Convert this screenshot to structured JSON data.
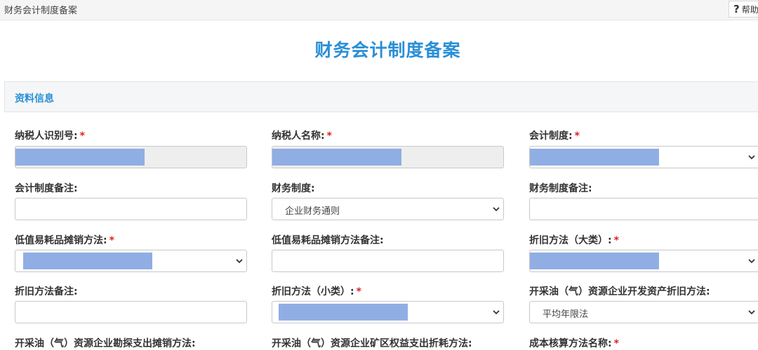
{
  "breadcrumb": "财务会计制度备案",
  "help": {
    "icon": "?",
    "label": "帮助"
  },
  "title": "财务会计制度备案",
  "section": {
    "title": "资料信息"
  },
  "colors": {
    "accent": "#2a8fd6",
    "required": "#e02020",
    "redaction": "#90aee4"
  },
  "fields": {
    "taxpayer_id": {
      "label": "纳税人识别号:",
      "required": "*"
    },
    "taxpayer_name": {
      "label": "纳税人名称:",
      "required": "*"
    },
    "accounting_system": {
      "label": "会计制度:",
      "required": "*"
    },
    "accounting_system_note": {
      "label": "会计制度备注:",
      "value": ""
    },
    "financial_system": {
      "label": "财务制度:",
      "value": "企业财务通则"
    },
    "financial_system_note": {
      "label": "财务制度备注:",
      "value": ""
    },
    "low_value_amortization": {
      "label": "低值易耗品摊销方法:",
      "required": "*"
    },
    "low_value_amortization_note": {
      "label": "低值易耗品摊销方法备注:",
      "value": ""
    },
    "depreciation_major": {
      "label": "折旧方法（大类）:",
      "required": "*"
    },
    "depreciation_note": {
      "label": "折旧方法备注:",
      "value": ""
    },
    "depreciation_minor": {
      "label": "折旧方法（小类）:",
      "required": "*"
    },
    "oil_gas_dev_depreciation": {
      "label": "开采油（气）资源企业开发资产折旧方法:",
      "value": "平均年限法"
    },
    "oil_gas_exploration": {
      "label": "开采油（气）资源企业勘探支出摊销方法:"
    },
    "oil_gas_mineral_rights": {
      "label": "开采油（气）资源企业矿区权益支出折耗方法:"
    },
    "cost_accounting": {
      "label": "成本核算方法名称:",
      "required": "*"
    }
  }
}
